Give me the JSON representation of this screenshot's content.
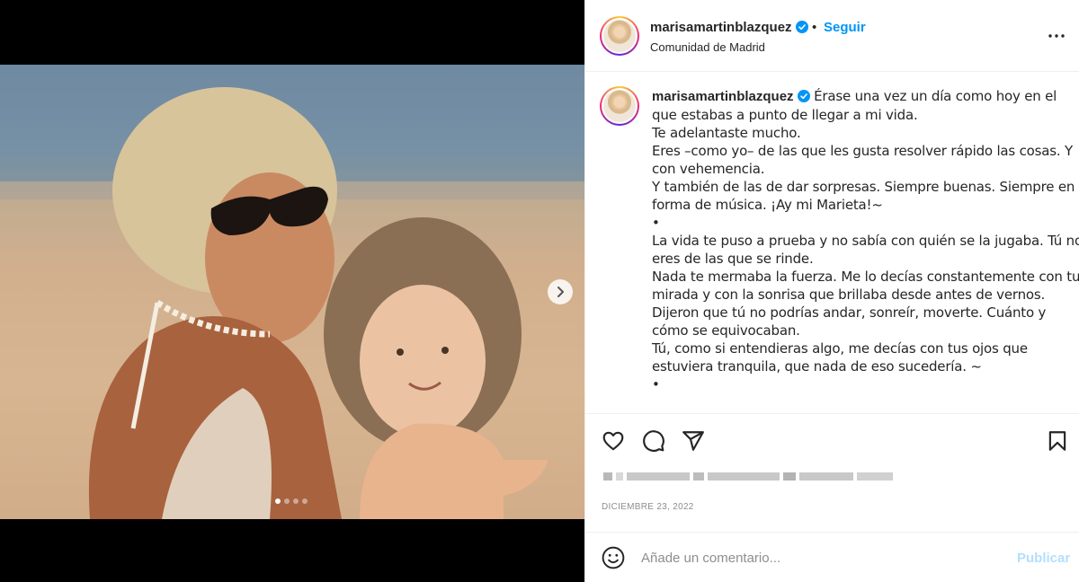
{
  "post": {
    "username": "marisamartinblazquez",
    "separator": "•",
    "follow_label": "Seguir",
    "location": "Comunidad de Madrid",
    "caption_lines": [
      "Érase una vez un día como hoy en el",
      "que estabas a punto de llegar a mi vida.",
      "Te adelantaste mucho.",
      "Eres –como yo– de las que les gusta resolver rápido las cosas. Y",
      "con vehemencia.",
      "Y también de las de dar sorpresas. Siempre buenas. Siempre en",
      "forma de música. ¡Ay mi Marieta!~",
      "•",
      "La vida te puso a prueba y no sabía con quién se la jugaba. Tú no",
      "eres de las que se rinde.",
      "Nada te mermaba la fuerza. Me lo decías constantemente con tu",
      "mirada y con la sonrisa que brillaba desde antes de vernos.",
      "Dijeron que tú no podrías andar, sonreír, moverte. Cuánto y",
      "cómo se equivocaban.",
      "Tú, como si entendieras algo, me decías con tus ojos que",
      "estuviera tranquila, que nada de eso sucedería. ~",
      "•"
    ],
    "date": "DICIEMBRE 23, 2022"
  },
  "carousel": {
    "slide_count": 4,
    "active_index": 0
  },
  "comment": {
    "placeholder": "Añade un comentario...",
    "publish_label": "Publicar"
  },
  "colors": {
    "accent": "#0095f6",
    "publish_disabled": "#b2dffc",
    "muted": "#8e8e8e",
    "text": "#262626"
  },
  "icons": {
    "verified": "verified-badge-icon",
    "more": "more-options-icon",
    "like": "heart-icon",
    "comment": "comment-bubble-icon",
    "share": "paper-plane-icon",
    "save": "bookmark-icon",
    "emoji": "emoji-smiley-icon",
    "next": "chevron-right-icon"
  }
}
